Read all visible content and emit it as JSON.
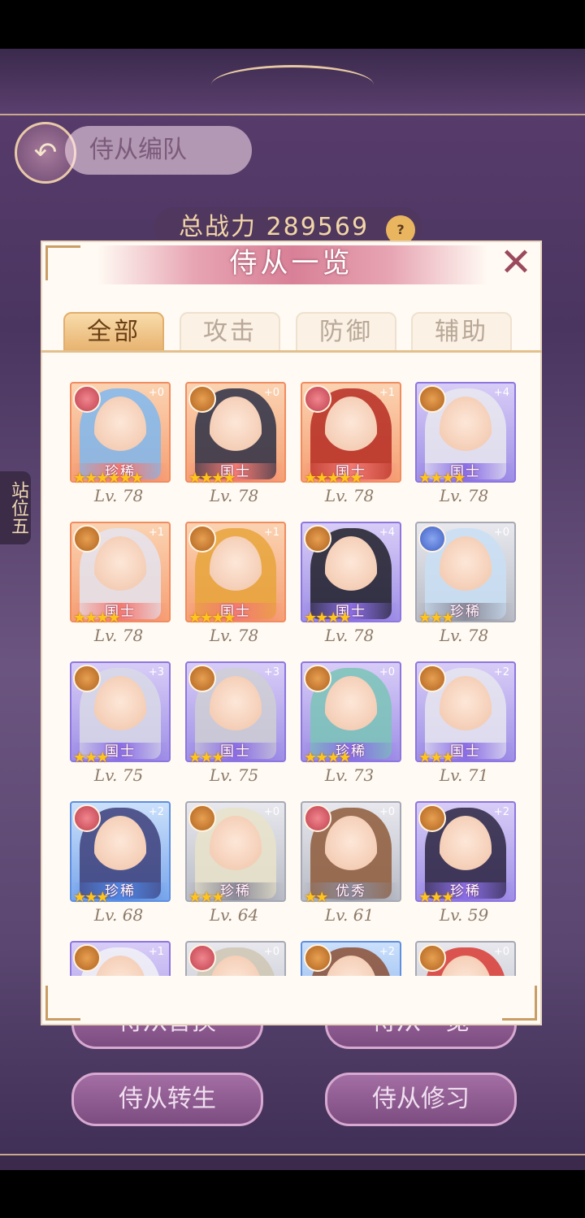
{
  "background": {
    "page_title": "侍从编队",
    "power_label": "总战力",
    "power_value": "289569",
    "help_icon": "?",
    "side_label": "站位五",
    "buttons": [
      "侍从替换",
      "侍从一览",
      "侍从转生",
      "侍从修习"
    ]
  },
  "modal": {
    "title": "侍从一览",
    "close_icon": "close-x-icon",
    "tabs": [
      {
        "label": "全部",
        "active": true
      },
      {
        "label": "攻击",
        "active": false
      },
      {
        "label": "防御",
        "active": false
      },
      {
        "label": "辅助",
        "active": false
      }
    ]
  },
  "cards": [
    {
      "frame": "orange",
      "type": "sup",
      "plus": "+0",
      "rank": "珍稀",
      "stars": 6,
      "level": "Lv. 78",
      "hair": "#7fb9f0"
    },
    {
      "frame": "orange",
      "type": "atk",
      "plus": "+0",
      "rank": "国士",
      "stars": 4,
      "level": "Lv. 78",
      "hair": "#2b2f45"
    },
    {
      "frame": "orange",
      "type": "sup",
      "plus": "+1",
      "rank": "国士",
      "stars": 5,
      "level": "Lv. 78",
      "hair": "#b52b22"
    },
    {
      "frame": "purple",
      "type": "atk",
      "plus": "+4",
      "rank": "国士",
      "stars": 4,
      "level": "Lv. 78",
      "hair": "#e9e9ee"
    },
    {
      "frame": "orange",
      "type": "atk",
      "plus": "+1",
      "rank": "国士",
      "stars": 4,
      "level": "Lv. 78",
      "hair": "#e4e4f0"
    },
    {
      "frame": "orange",
      "type": "atk",
      "plus": "+1",
      "rank": "国士",
      "stars": 4,
      "level": "Lv. 78",
      "hair": "#e7a53b"
    },
    {
      "frame": "purple",
      "type": "atk",
      "plus": "+4",
      "rank": "国士",
      "stars": 4,
      "level": "Lv. 78",
      "hair": "#1f1f28"
    },
    {
      "frame": "grey",
      "type": "def",
      "plus": "+0",
      "rank": "珍稀",
      "stars": 3,
      "level": "Lv. 78",
      "hair": "#c9dff4"
    },
    {
      "frame": "purple",
      "type": "atk",
      "plus": "+3",
      "rank": "国士",
      "stars": 3,
      "level": "Lv. 75",
      "hair": "#d8d9e6"
    },
    {
      "frame": "purple",
      "type": "atk",
      "plus": "+3",
      "rank": "国士",
      "stars": 3,
      "level": "Lv. 75",
      "hair": "#cfcfd4"
    },
    {
      "frame": "purple",
      "type": "atk",
      "plus": "+0",
      "rank": "珍稀",
      "stars": 4,
      "level": "Lv. 73",
      "hair": "#7ac4b7"
    },
    {
      "frame": "purple",
      "type": "atk",
      "plus": "+2",
      "rank": "国士",
      "stars": 3,
      "level": "Lv. 71",
      "hair": "#e6e6ef"
    },
    {
      "frame": "blue",
      "type": "sup",
      "plus": "+2",
      "rank": "珍稀",
      "stars": 3,
      "level": "Lv. 68",
      "hair": "#3d3f7a"
    },
    {
      "frame": "grey",
      "type": "atk",
      "plus": "+0",
      "rank": "珍稀",
      "stars": 3,
      "level": "Lv. 64",
      "hair": "#e9e3c9"
    },
    {
      "frame": "grey",
      "type": "sup",
      "plus": "+0",
      "rank": "优秀",
      "stars": 2,
      "level": "Lv. 61",
      "hair": "#8e5a3a"
    },
    {
      "frame": "purple",
      "type": "atk",
      "plus": "+2",
      "rank": "珍稀",
      "stars": 3,
      "level": "Lv. 59",
      "hair": "#2b2540"
    },
    {
      "frame": "purple",
      "type": "atk",
      "plus": "+1",
      "rank": "",
      "stars": 0,
      "level": "",
      "hair": "#f2f2f6"
    },
    {
      "frame": "grey",
      "type": "sup",
      "plus": "+0",
      "rank": "",
      "stars": 0,
      "level": "",
      "hair": "#cfc7b4"
    },
    {
      "frame": "blue",
      "type": "atk",
      "plus": "+2",
      "rank": "",
      "stars": 0,
      "level": "",
      "hair": "#8b4f34"
    },
    {
      "frame": "grey",
      "type": "atk",
      "plus": "+0",
      "rank": "",
      "stars": 0,
      "level": "",
      "hair": "#d93a32"
    }
  ]
}
